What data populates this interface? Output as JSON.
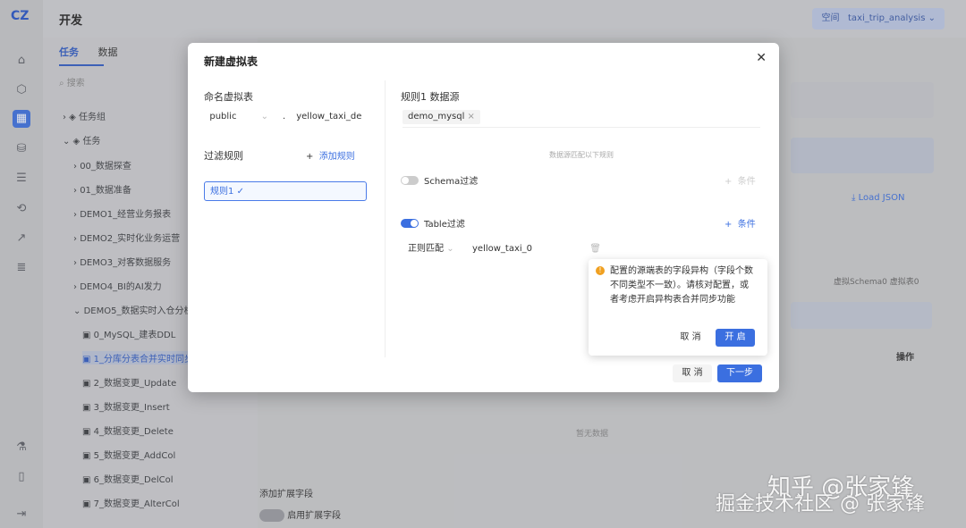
{
  "app": {
    "title": "开发",
    "project_env": "空间",
    "project_name": "taxi_trip_analysis"
  },
  "tabs": {
    "tasks": "任务",
    "data": "数据"
  },
  "tree": {
    "search_placeholder": "搜索",
    "groups": [
      {
        "label": "任务组"
      },
      {
        "label": "任务"
      }
    ],
    "items": [
      "00_数据探查",
      "01_数据准备",
      "DEMO1_经营业务报表",
      "DEMO2_实时化业务运营",
      "DEMO3_对客数据服务",
      "DEMO4_BI的AI发力",
      "DEMO5_数据实时入仓分析",
      "0_MySQL_建表DDL",
      "1_分库分表合并实时同步",
      "2_数据变更_Update",
      "3_数据变更_Insert",
      "4_数据变更_Delete",
      "5_数据变更_AddCol",
      "6_数据变更_DelCol",
      "7_数据变更_AlterCol"
    ]
  },
  "main": {
    "load_json": "Load JSON",
    "virtual_info": "虚拟Schema0 虚拟表0",
    "ops_header": "操作",
    "empty": "暂无数据",
    "add_field": "添加扩展字段",
    "enable_field": "启用扩展字段"
  },
  "modal": {
    "title": "新建虚拟表",
    "name_label": "命名虚拟表",
    "schema_value": "public",
    "table_value": "yellow_taxi_de",
    "filter_label": "过滤规则",
    "add_rule": "添加规则",
    "rule1": "规则1",
    "rule1_source_label": "规则1 数据源",
    "source_tag": "demo_mysql",
    "match_note": "数据源匹配以下规则",
    "schema_filter": "Schema过滤",
    "schema_cond": "条件",
    "table_filter": "Table过滤",
    "table_cond": "条件",
    "match_mode": "正则匹配",
    "match_value": "yellow_taxi_0",
    "popover_text": "配置的源端表的字段异构（字段个数不同类型不一致）。请核对配置，或者考虑开启异构表合并同步功能",
    "popover_cancel": "取 消",
    "popover_ok": "开 启",
    "cancel": "取 消",
    "next": "下一步"
  },
  "watermarks": {
    "line1": "知乎 @张家锋",
    "line2": "掘金技术社区 @ 张家锋"
  },
  "colors": {
    "primary": "#3b6fe0",
    "warning": "#f0a020"
  }
}
